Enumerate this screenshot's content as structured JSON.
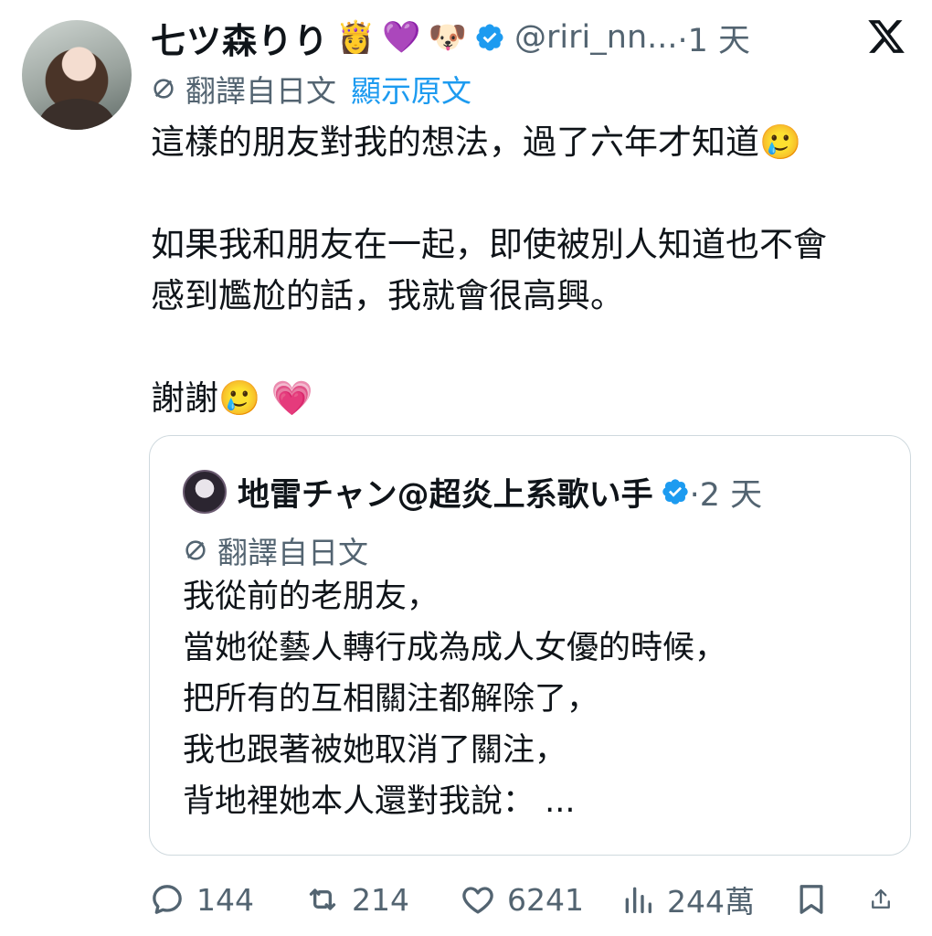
{
  "tweet": {
    "display_name": "七ツ森りり",
    "emojis": [
      "👸",
      "💜",
      "🐶"
    ],
    "handle": "@riri_nn...",
    "time": "·1 天",
    "translated_from": "翻譯自日文",
    "show_original": "顯示原文",
    "body": {
      "line1": "這樣的朋友對我的想法，過了六年才知道🥲",
      "line2": "如果我和朋友在一起，即使被別人知道也不會",
      "line3": "感到尷尬的話，我就會很高興。",
      "line4": "謝謝🥲 💗"
    }
  },
  "quote": {
    "display_name": "地雷チャン@超炎上系歌い手",
    "time": "·2 天",
    "translated_from": "翻譯自日文",
    "lines": [
      "我從前的老朋友，",
      "當她從藝人轉行成為成人女優的時候，",
      "把所有的互相關注都解除了，",
      "我也跟著被她取消了關注，",
      "背地裡她本人還對我說：  ..."
    ]
  },
  "actions": {
    "replies": "144",
    "reposts": "214",
    "likes": "6241",
    "views": "244萬"
  },
  "colors": {
    "text": "#0f1419",
    "secondary": "#536471",
    "accent": "#1d9bf0",
    "verified": "#1d9bf0",
    "border": "#cfd9de"
  }
}
